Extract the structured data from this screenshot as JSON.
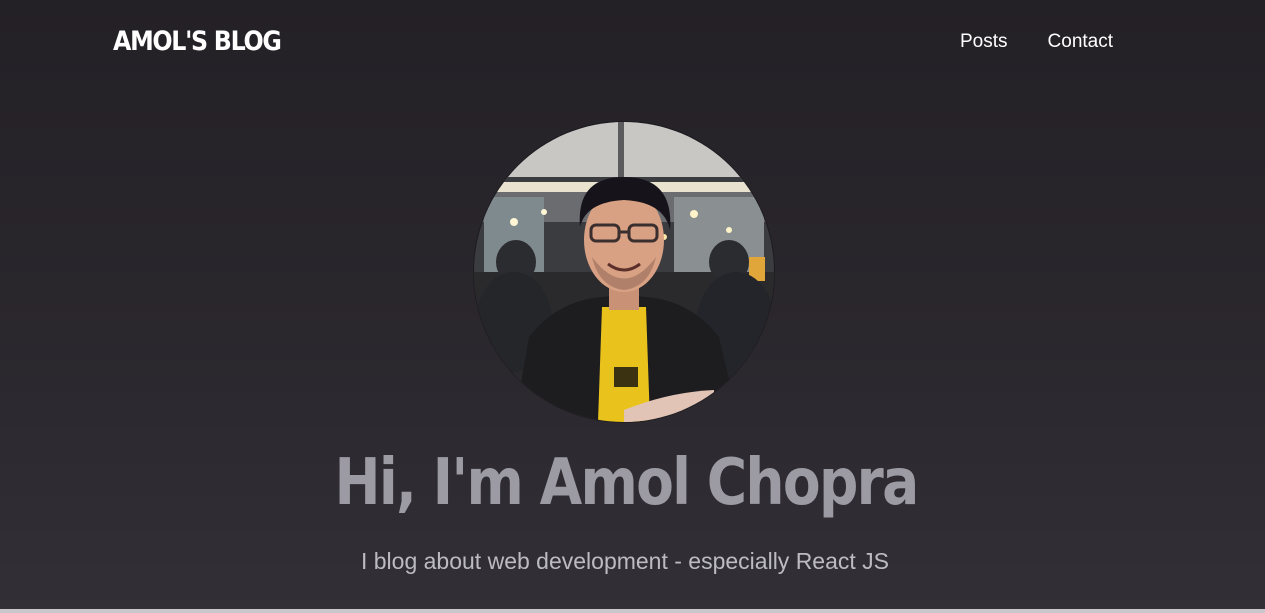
{
  "header": {
    "brand": "AMOL'S BLOG",
    "nav": [
      {
        "label": "Posts"
      },
      {
        "label": "Contact"
      }
    ]
  },
  "hero": {
    "avatar_alt": "profile-photo",
    "title": "Hi, I'm Amol Chopra",
    "subtitle": "I blog about web development - especially React JS"
  },
  "colors": {
    "background_top": "#232026",
    "background_bottom": "#322f37",
    "title": "#9c9aa2",
    "subtitle": "#bdbbc2",
    "nav_text": "#ffffff"
  }
}
